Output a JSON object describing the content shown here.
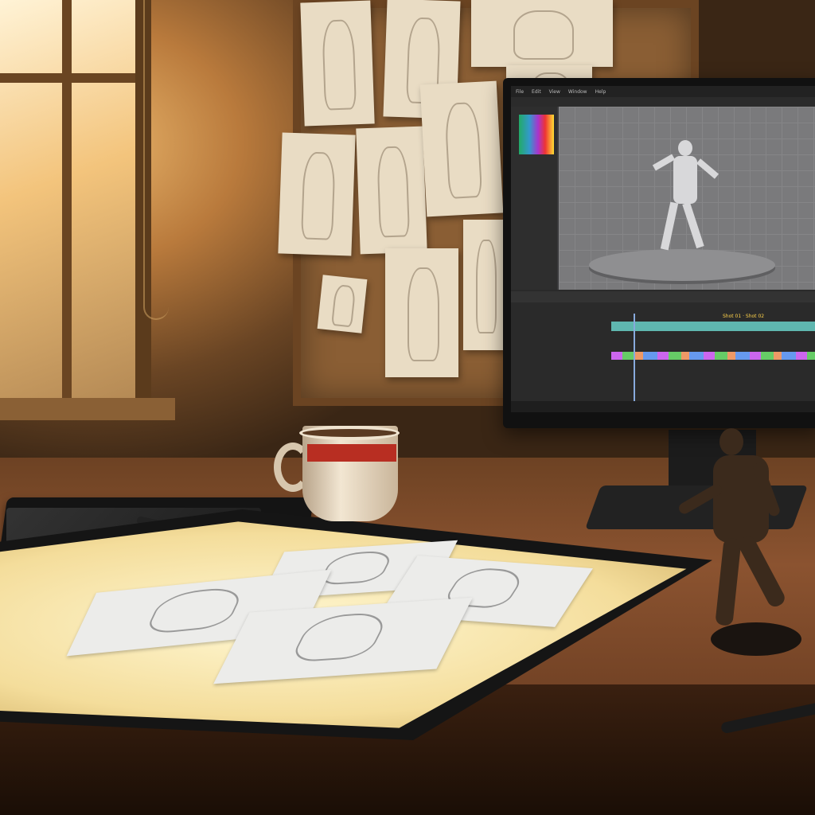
{
  "scene": {
    "description_tags": [
      "animation-workspace",
      "light-table",
      "monitor",
      "corkboard",
      "mug",
      "figurine"
    ]
  },
  "monitor": {
    "menu_items": [
      "File",
      "Edit",
      "View",
      "Window",
      "Help"
    ],
    "timeline_clip_label": "Shot 01 · Shot 02",
    "brand": ""
  },
  "colors": {
    "sunlight": "#f3c47c",
    "mug_stripe": "#b82e22",
    "timeline_teal": "#5fb7b0",
    "playhead": "#88aadd"
  }
}
